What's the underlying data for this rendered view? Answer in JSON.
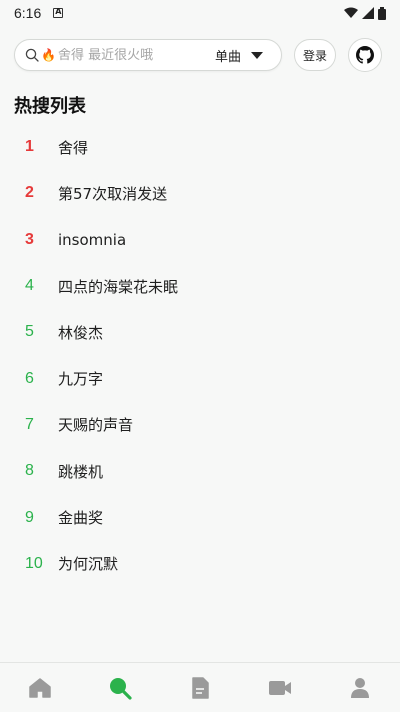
{
  "status_bar": {
    "time": "6:16"
  },
  "search": {
    "placeholder": "舍得 最近很火哦",
    "type_label": "单曲"
  },
  "header": {
    "login_label": "登录"
  },
  "hot_section": {
    "title": "热搜列表"
  },
  "hot_list": [
    {
      "rank": "1",
      "word": "舍得"
    },
    {
      "rank": "2",
      "word": "第57次取消发送"
    },
    {
      "rank": "3",
      "word": "insomnia"
    },
    {
      "rank": "4",
      "word": "四点的海棠花未眠"
    },
    {
      "rank": "5",
      "word": "林俊杰"
    },
    {
      "rank": "6",
      "word": "九万字"
    },
    {
      "rank": "7",
      "word": "天赐的声音"
    },
    {
      "rank": "8",
      "word": "跳楼机"
    },
    {
      "rank": "9",
      "word": "金曲奖"
    },
    {
      "rank": "10",
      "word": "为何沉默"
    }
  ],
  "tab_bar": {
    "tabs": [
      {
        "icon": "home-icon",
        "active": false
      },
      {
        "icon": "search-icon",
        "active": true
      },
      {
        "icon": "document-icon",
        "active": false
      },
      {
        "icon": "video-icon",
        "active": false
      },
      {
        "icon": "user-icon",
        "active": false
      }
    ]
  },
  "colors": {
    "accent": "#2bb24c",
    "top_rank": "#e63a3a",
    "inactive_icon": "#9a9a9a"
  }
}
